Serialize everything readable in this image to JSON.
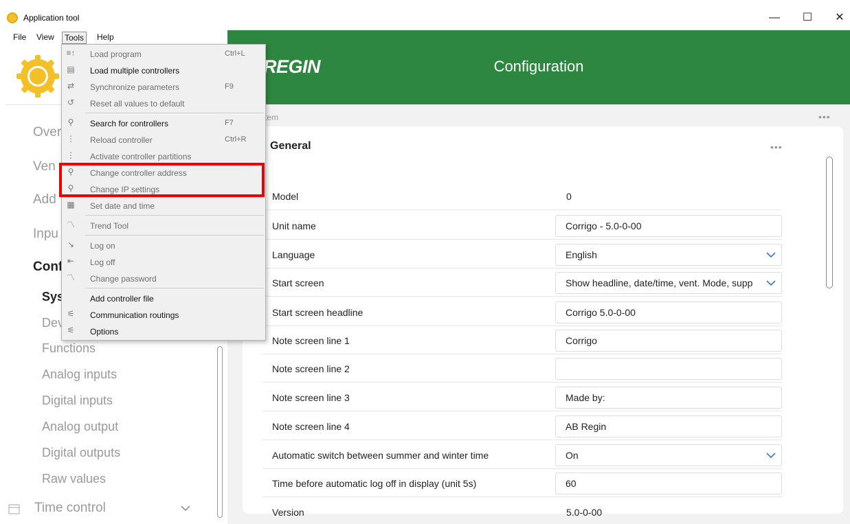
{
  "window": {
    "title": "Application tool",
    "minimize": "—",
    "maximize": "☐",
    "close": "✕"
  },
  "menubar": [
    "File",
    "View",
    "Tools",
    "Help"
  ],
  "header": {
    "brand": "REGIN",
    "title": "Configuration"
  },
  "sidebar": {
    "nav_partial": [
      "Over",
      "Ven",
      "Add",
      "Inpu",
      "Conf"
    ],
    "sub_partial": [
      "Sys",
      "Dev"
    ],
    "items": [
      "Functions",
      "Analog inputs",
      "Digital inputs",
      "Analog output",
      "Digital outputs",
      "Raw values"
    ],
    "time_control": "Time control"
  },
  "content": {
    "section": "stem",
    "card_title": "General",
    "rows": [
      {
        "label": "Model",
        "value": "0",
        "kind": "text"
      },
      {
        "label": "Unit name",
        "value": "Corrigo - 5.0-0-00",
        "kind": "input"
      },
      {
        "label": "Language",
        "value": "English",
        "kind": "select"
      },
      {
        "label": "Start screen",
        "value": "Show headline, date/time, vent. Mode, supp",
        "kind": "select"
      },
      {
        "label": "Start screen headline",
        "value": "Corrigo 5.0-0-00",
        "kind": "input"
      },
      {
        "label": "Note screen line 1",
        "value": "Corrigo",
        "kind": "input"
      },
      {
        "label": "Note screen line 2",
        "value": "",
        "kind": "input"
      },
      {
        "label": "Note screen line 3",
        "value": "Made by:",
        "kind": "input"
      },
      {
        "label": "Note screen line 4",
        "value": "AB Regin",
        "kind": "input"
      },
      {
        "label": "Automatic switch between summer and winter time",
        "value": "On",
        "kind": "select"
      },
      {
        "label": "Time before automatic log off in display (unit 5s)",
        "value": "60",
        "kind": "input"
      },
      {
        "label": "Version",
        "value": "5.0-0-00",
        "kind": "text"
      }
    ]
  },
  "tools_menu": [
    {
      "label": "Load program",
      "shortcut": "Ctrl+L",
      "enabled": false,
      "icon": "≡↑"
    },
    {
      "label": "Load multiple controllers",
      "shortcut": "",
      "enabled": true,
      "icon": "▤"
    },
    {
      "label": "Synchronize parameters",
      "shortcut": "F9",
      "enabled": false,
      "icon": "⇄"
    },
    {
      "label": "Reset all values to default",
      "shortcut": "",
      "enabled": false,
      "icon": "↺",
      "sep_after": true
    },
    {
      "label": "Search for controllers",
      "shortcut": "F7",
      "enabled": true,
      "icon": "⚲"
    },
    {
      "label": "Reload controller",
      "shortcut": "Ctrl+R",
      "enabled": false,
      "icon": "⋮"
    },
    {
      "label": "Activate controller partitions",
      "shortcut": "",
      "enabled": false,
      "icon": "⋮"
    },
    {
      "label": "Change controller address",
      "shortcut": "",
      "enabled": false,
      "icon": "⚲"
    },
    {
      "label": "Change IP settings",
      "shortcut": "",
      "enabled": false,
      "icon": "⚲"
    },
    {
      "label": "Set date and time",
      "shortcut": "",
      "enabled": false,
      "icon": "▦",
      "sep_after": true
    },
    {
      "label": "Trend Tool",
      "shortcut": "",
      "enabled": false,
      "icon": "〽",
      "sep_after": true
    },
    {
      "label": "Log on",
      "shortcut": "",
      "enabled": false,
      "icon": "↘"
    },
    {
      "label": "Log off",
      "shortcut": "",
      "enabled": false,
      "icon": "⇤"
    },
    {
      "label": "Change password",
      "shortcut": "",
      "enabled": false,
      "icon": "〽",
      "sep_after": true
    },
    {
      "label": "Add controller file",
      "shortcut": "",
      "enabled": true,
      "icon": ""
    },
    {
      "label": "Communication routings",
      "shortcut": "",
      "enabled": true,
      "icon": "⚟"
    },
    {
      "label": "Options",
      "shortcut": "",
      "enabled": true,
      "icon": "⚟"
    }
  ],
  "colors": {
    "header": "#2e8740",
    "highlight": "#ee0000",
    "logo": "#f4c028"
  }
}
